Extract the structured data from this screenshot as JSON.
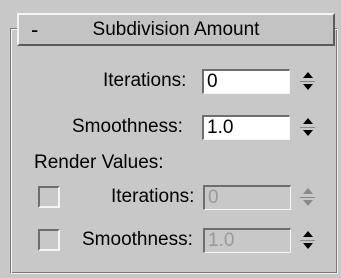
{
  "rollout": {
    "toggle_symbol": "-",
    "title": "Subdivision Amount"
  },
  "iterations": {
    "label": "Iterations:",
    "value": "0"
  },
  "smoothness": {
    "label": "Smoothness:",
    "value": "1.0"
  },
  "render_values": {
    "heading": "Render Values:",
    "iterations": {
      "label": "Iterations:",
      "value": "0",
      "checked": false
    },
    "smoothness": {
      "label": "Smoothness:",
      "value": "1.0",
      "checked": false
    }
  },
  "icons": {
    "spinner_up": "triangle-up-icon",
    "spinner_down": "triangle-down-icon"
  }
}
